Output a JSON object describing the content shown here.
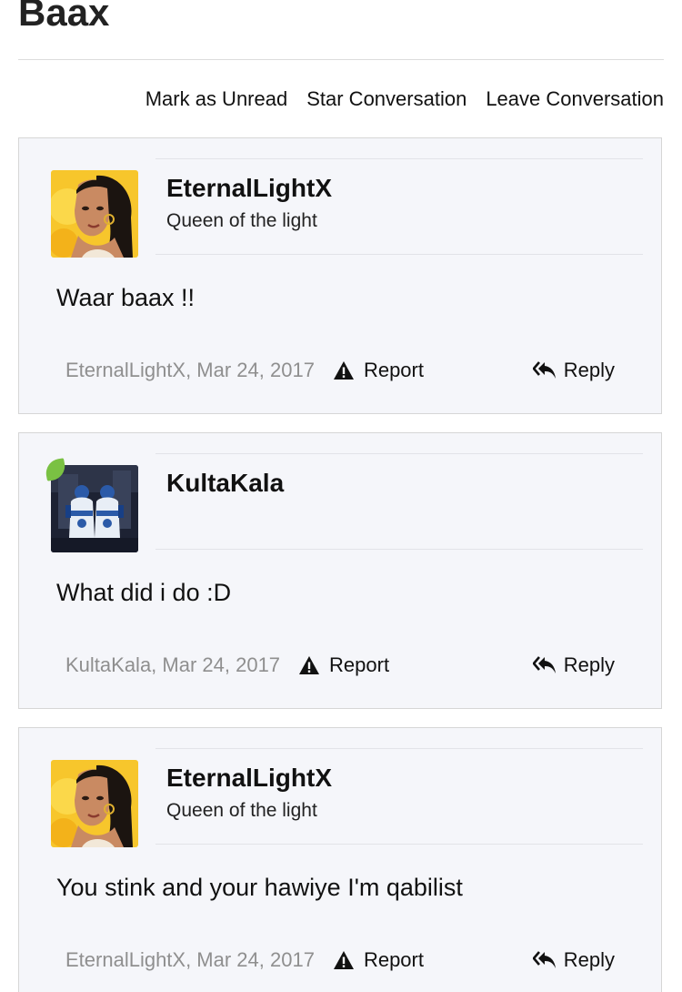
{
  "page": {
    "title": "Baax"
  },
  "actions": {
    "mark_unread": "Mark as Unread",
    "star": "Star Conversation",
    "leave": "Leave Conversation"
  },
  "messages": [
    {
      "username": "EternalLightX",
      "user_title": "Queen of the light",
      "avatar": "avatar-eternallightx",
      "online": false,
      "body": "Waar baax !!",
      "meta": "EternalLightX, Mar 24, 2017",
      "report_label": "Report",
      "reply_label": "Reply"
    },
    {
      "username": "KultaKala",
      "user_title": "",
      "avatar": "avatar-kultakala",
      "online": true,
      "body": "What did i do :D",
      "meta": "KultaKala, Mar 24, 2017",
      "report_label": "Report",
      "reply_label": "Reply"
    },
    {
      "username": "EternalLightX",
      "user_title": "Queen of the light",
      "avatar": "avatar-eternallightx",
      "online": false,
      "body": "You stink and your hawiye I'm qabilist",
      "meta": "EternalLightX, Mar 24, 2017",
      "report_label": "Report",
      "reply_label": "Reply"
    }
  ],
  "icons": {
    "report": "warning-triangle-icon",
    "reply": "reply-all-arrow-icon"
  },
  "colors": {
    "panel_bg": "#f5f6fa",
    "meta_text": "#8f8f8f",
    "online_indicator": "#7ac143"
  }
}
